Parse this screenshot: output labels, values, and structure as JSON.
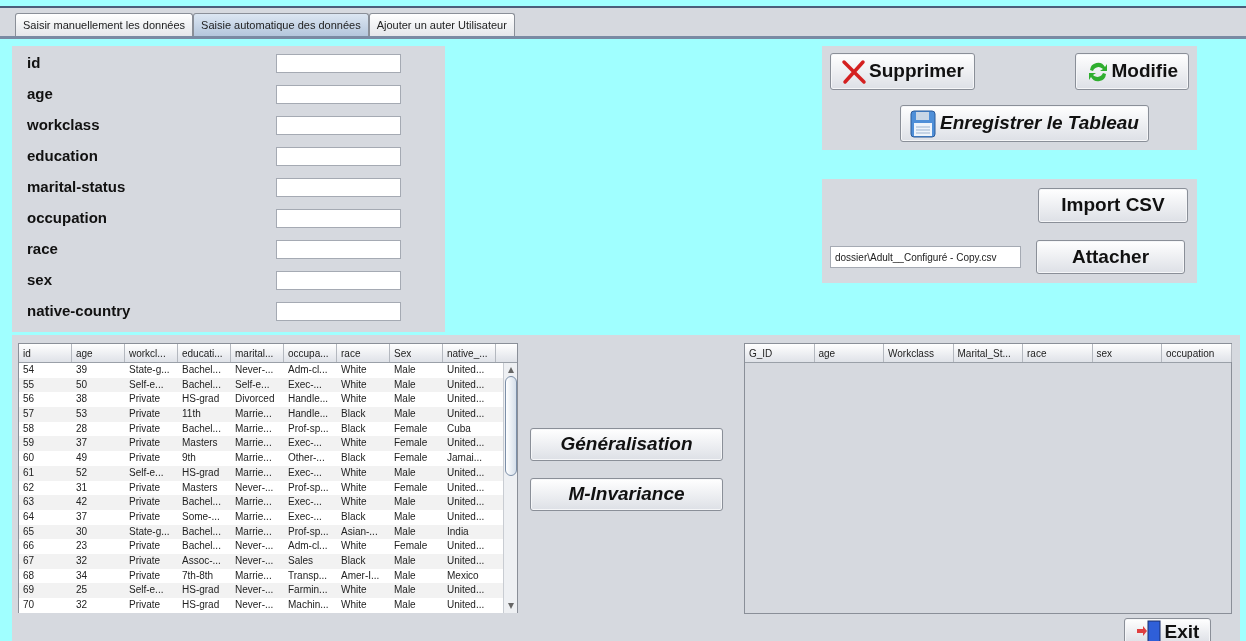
{
  "tabs": [
    {
      "label": "Saisir manuellement les données",
      "selected": false
    },
    {
      "label": "Saisie automatique des données",
      "selected": true
    },
    {
      "label": "Ajouter un auter Utilisateur",
      "selected": false
    }
  ],
  "form": {
    "fields": [
      {
        "label": "id"
      },
      {
        "label": "age"
      },
      {
        "label": "workclass"
      },
      {
        "label": "education"
      },
      {
        "label": "marital-status"
      },
      {
        "label": "occupation"
      },
      {
        "label": "race"
      },
      {
        "label": "sex"
      },
      {
        "label": "native-country"
      }
    ]
  },
  "actions": [
    {
      "label": "Supprimer",
      "kind": "delete"
    },
    {
      "label": "Modifie",
      "kind": "refresh"
    },
    {
      "label": "Enregistrer le Tableau",
      "kind": "save"
    }
  ],
  "import": {
    "import_button": "Import CSV",
    "attach_button": "Attacher",
    "file_path": "dossier\\Adult__Configuré - Copy.csv"
  },
  "source_table": {
    "columns": [
      "id",
      "age",
      "workcl...",
      "educati...",
      "marital...",
      "occupa...",
      "race",
      "Sex",
      "native_..."
    ],
    "rows": [
      [
        "54",
        "39",
        "State-g...",
        "Bachel...",
        "Never-...",
        "Adm-cl...",
        "White",
        "Male",
        "United..."
      ],
      [
        "55",
        "50",
        "Self-e...",
        "Bachel...",
        "Self-e...",
        "Exec-...",
        "White",
        "Male",
        "United..."
      ],
      [
        "56",
        "38",
        "Private",
        "HS-grad",
        "Divorced",
        "Handle...",
        "White",
        "Male",
        "United..."
      ],
      [
        "57",
        "53",
        "Private",
        "11th",
        "Marrie...",
        "Handle...",
        "Black",
        "Male",
        "United..."
      ],
      [
        "58",
        "28",
        "Private",
        "Bachel...",
        "Marrie...",
        "Prof-sp...",
        "Black",
        "Female",
        "Cuba"
      ],
      [
        "59",
        "37",
        "Private",
        "Masters",
        "Marrie...",
        "Exec-...",
        "White",
        "Female",
        "United..."
      ],
      [
        "60",
        "49",
        "Private",
        "9th",
        "Marrie...",
        "Other-...",
        "Black",
        "Female",
        "Jamai..."
      ],
      [
        "61",
        "52",
        "Self-e...",
        "HS-grad",
        "Marrie...",
        "Exec-...",
        "White",
        "Male",
        "United..."
      ],
      [
        "62",
        "31",
        "Private",
        "Masters",
        "Never-...",
        "Prof-sp...",
        "White",
        "Female",
        "United..."
      ],
      [
        "63",
        "42",
        "Private",
        "Bachel...",
        "Marrie...",
        "Exec-...",
        "White",
        "Male",
        "United..."
      ],
      [
        "64",
        "37",
        "Private",
        "Some-...",
        "Marrie...",
        "Exec-...",
        "Black",
        "Male",
        "United..."
      ],
      [
        "65",
        "30",
        "State-g...",
        "Bachel...",
        "Marrie...",
        "Prof-sp...",
        "Asian-...",
        "Male",
        "India"
      ],
      [
        "66",
        "23",
        "Private",
        "Bachel...",
        "Never-...",
        "Adm-cl...",
        "White",
        "Female",
        "United..."
      ],
      [
        "67",
        "32",
        "Private",
        "Assoc-...",
        "Never-...",
        "Sales",
        "Black",
        "Male",
        "United..."
      ],
      [
        "68",
        "34",
        "Private",
        "7th-8th",
        "Marrie...",
        "Transp...",
        "Amer-I...",
        "Male",
        "Mexico"
      ],
      [
        "69",
        "25",
        "Self-e...",
        "HS-grad",
        "Never-...",
        "Farmin...",
        "White",
        "Male",
        "United..."
      ],
      [
        "70",
        "32",
        "Private",
        "HS-grad",
        "Never-...",
        "Machin...",
        "White",
        "Male",
        "United..."
      ]
    ]
  },
  "algorithm_buttons": [
    "Généralisation",
    "M-Invariance"
  ],
  "result_table": {
    "columns": [
      "G_ID",
      "age",
      "Workclass",
      "Marital_St...",
      "race",
      "sex",
      "occupation"
    ]
  },
  "exit_button": "Exit"
}
